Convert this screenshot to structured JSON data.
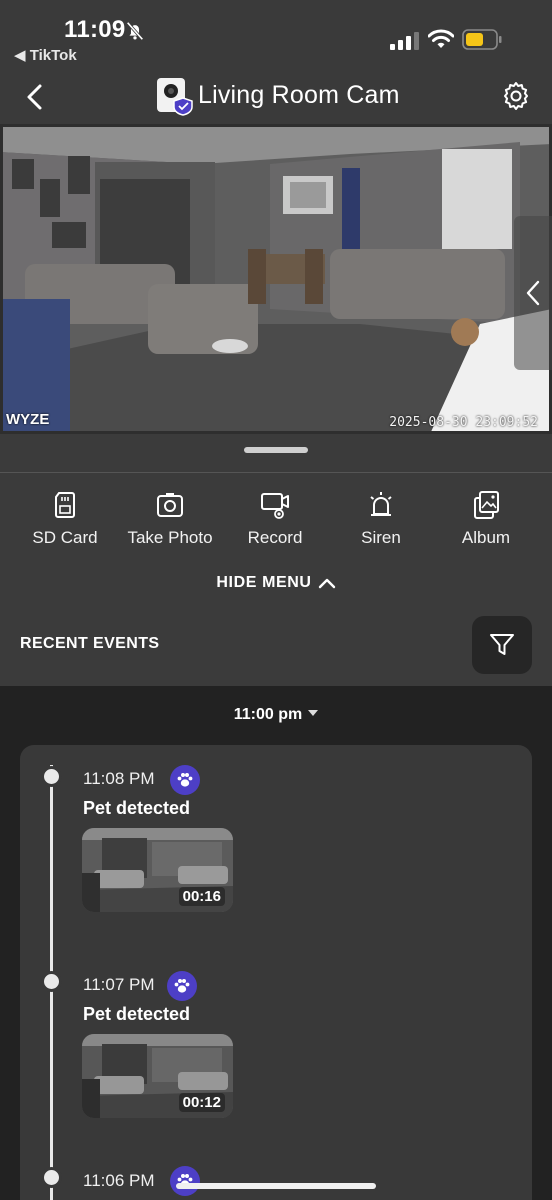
{
  "status_bar": {
    "time": "11:09",
    "back_app": "◀ TikTok",
    "icons": [
      "bell-slash-icon",
      "signal-icon",
      "wifi-icon",
      "battery-icon"
    ],
    "battery_color": "#f5c518"
  },
  "nav": {
    "title": "Living Room Cam",
    "icons": [
      "back-chevron-icon",
      "camera-thumbnail",
      "gear-icon"
    ]
  },
  "video": {
    "timestamp": "2025-08-30 23:09:52",
    "watermark": "WYZE"
  },
  "controls": [
    {
      "label": "SD Card",
      "icon": "sd-card-icon"
    },
    {
      "label": "Take Photo",
      "icon": "camera-icon"
    },
    {
      "label": "Record",
      "icon": "record-icon"
    },
    {
      "label": "Siren",
      "icon": "siren-icon"
    },
    {
      "label": "Album",
      "icon": "album-icon"
    }
  ],
  "hide_menu_label": "HIDE MENU",
  "recent_events": {
    "title": "RECENT EVENTS",
    "hour": "11:00 pm",
    "events": [
      {
        "time": "11:08 PM",
        "title": "Pet detected",
        "duration": "00:16",
        "icon": "paw-icon"
      },
      {
        "time": "11:07 PM",
        "title": "Pet detected",
        "duration": "00:12",
        "icon": "paw-icon"
      },
      {
        "time": "11:06 PM",
        "icon": "paw-icon"
      }
    ]
  },
  "colors": {
    "background": "#3a3a3a",
    "events_background": "#222222",
    "card": "#393939",
    "pet_badge": "#4d3fc6"
  }
}
